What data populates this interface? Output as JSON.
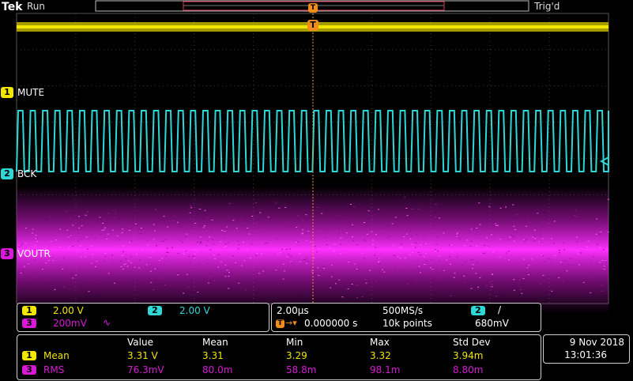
{
  "header": {
    "brand": "Tek",
    "run_state": "Run",
    "trig_state": "Trig'd",
    "trigger_marker_top": "T",
    "trigger_marker_main": "T"
  },
  "channels": [
    {
      "number": "1",
      "label": "MUTE",
      "color": "#f2e600",
      "scale": "2.00 V"
    },
    {
      "number": "2",
      "label": "BCK",
      "color": "#2fd6d6",
      "scale": "2.00 V"
    },
    {
      "number": "3",
      "label": "VOUTR",
      "color": "#d81ad8",
      "scale": "200mV",
      "bw_symbol": "∿"
    }
  ],
  "timebase": {
    "horizontal_scale": "2.00µs",
    "sample_rate": "500MS/s",
    "trigger_position": "0.000000 s",
    "record_length": "10k points",
    "trigger_channel": "2",
    "trigger_slope": "/",
    "trigger_level": "680mV"
  },
  "measurements": {
    "headers": [
      "Value",
      "Mean",
      "Min",
      "Max",
      "Std Dev"
    ],
    "rows": [
      {
        "channel": "1",
        "name": "Mean",
        "color": "#f2e600",
        "values": [
          "3.31 V",
          "3.31",
          "3.29",
          "3.32",
          "3.94m"
        ]
      },
      {
        "channel": "3",
        "name": "RMS",
        "color": "#d81ad8",
        "values": [
          "76.3mV",
          "80.0m",
          "58.8m",
          "98.1m",
          "8.80m"
        ]
      }
    ]
  },
  "datetime": {
    "date": "9 Nov 2018",
    "time": "13:01:36"
  }
}
